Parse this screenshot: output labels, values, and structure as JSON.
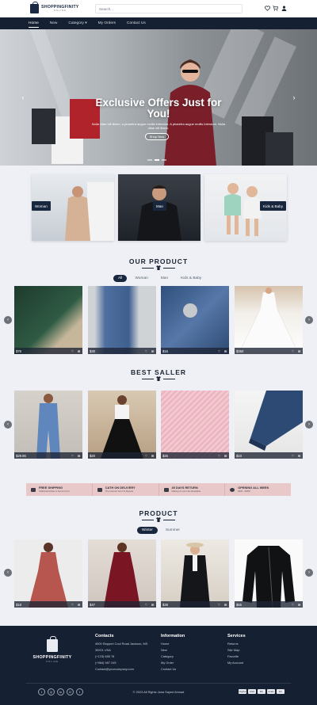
{
  "brand": {
    "name": "SHOPPINGFINITY",
    "tagline": "ONLINE"
  },
  "search": {
    "placeholder": "Search..."
  },
  "nav": {
    "items": [
      "Home",
      "New",
      "Category ▾",
      "My Orders",
      "Contact Us"
    ],
    "active": "Home"
  },
  "hero": {
    "title": "Exclusive Offers Just for You!",
    "subtitle": "Nulla vitae elit libero, a pharetra augue mollis interdum. A pharetra augue mollis interdum. Nulla vitae elit libero.",
    "button": "Shop Now"
  },
  "categories": [
    "Woman",
    "Man",
    "Kids & Baby"
  ],
  "our_product": {
    "title": "OUR PRODUCT",
    "tabs": [
      "All",
      "Woman",
      "Man",
      "Kids & Baby"
    ],
    "items": [
      {
        "price": "$76"
      },
      {
        "price": "$30"
      },
      {
        "price": "$15"
      },
      {
        "price": "$350"
      }
    ]
  },
  "best_seller": {
    "title": "BEST SALLER",
    "items": [
      {
        "price": "$29.95"
      },
      {
        "price": "$20"
      },
      {
        "price": "$25"
      },
      {
        "price": "$10"
      }
    ]
  },
  "features": [
    {
      "title": "FREE SHIPPING",
      "sub": "Sollicitudin/vitae in Somni Form"
    },
    {
      "title": "CATH ON DELIVERY",
      "sub": "The Internet Tend To Repeat"
    },
    {
      "title": "45 DAYS RETURN",
      "sub": "Making it Look Like Readable"
    },
    {
      "title": "OPENING ALL WEEK",
      "sub": "8AM - 09PM"
    }
  ],
  "product": {
    "title": "PRODUCT",
    "tabs": [
      "Winter",
      "Summer"
    ],
    "items": [
      {
        "price": "$18"
      },
      {
        "price": "$47"
      },
      {
        "price": "$38"
      },
      {
        "price": "$55"
      }
    ]
  },
  "footer": {
    "contacts": {
      "title": "Contacts",
      "lines": [
        "4000 Rapport Cool Road Jackson, MS",
        "39201 USA",
        "(+123) 685 78",
        "(+964) 987 245",
        "Contact@yourcompany.com"
      ]
    },
    "information": {
      "title": "Information",
      "lines": [
        "Home",
        "New",
        "Category",
        "My Order",
        "Contact Us"
      ]
    },
    "services": {
      "title": "Services",
      "lines": [
        "Returns",
        "Site Map",
        "Favorite",
        "My Account"
      ]
    },
    "copyright": "© 2023 All Rights Jana Sayed Ahmad",
    "social": [
      "f",
      "◎",
      "in",
      "G",
      "t"
    ],
    "payments": [
      "PayPal",
      "VISA",
      "MC",
      "AmEx",
      "DC"
    ]
  },
  "colors": {
    "navy": "#152033",
    "accent_badge": "#18263e",
    "feature_bg": "#e8c8c8",
    "page_bg": "#eef0f6"
  }
}
